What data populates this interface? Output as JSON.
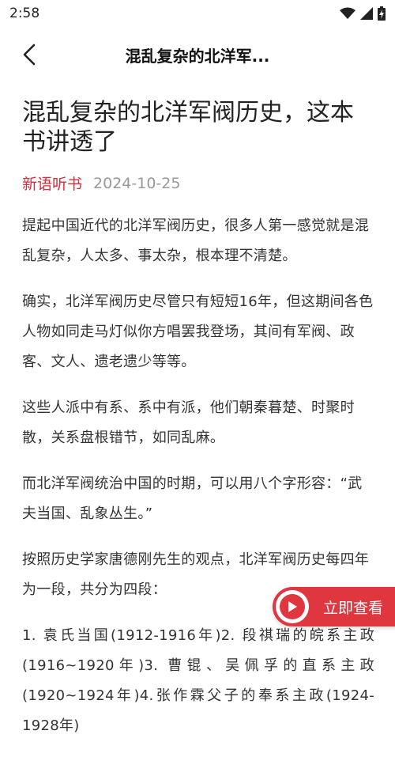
{
  "status": {
    "time": "2:58"
  },
  "nav": {
    "title": "混乱复杂的北洋军..."
  },
  "article": {
    "title": "混乱复杂的北洋军阀历史，这本书讲透了",
    "source": "新语听书",
    "date": "2024-10-25",
    "paragraphs": [
      "提起中国近代的北洋军阀历史，很多人第一感觉就是混乱复杂，人太多、事太杂，根本理不清楚。",
      "确实，北洋军阀历史尽管只有短短16年，但这期间各色人物如同走马灯似你方唱罢我登场，其间有军阀、政客、文人、遗老遗少等等。",
      "这些人派中有系、系中有派，他们朝秦暮楚、时聚时散，关系盘根错节，如同乱麻。",
      "而北洋军阀统治中国的时期，可以用八个字形容：“武夫当国、乱象丛生。”",
      "按照历史学家唐德刚先生的观点，北洋军阀历史每四年为一段，共分为四段：",
      "1. 袁氏当国(1912-1916年)2. 段祺瑞的皖系主政(1916~1920年)3. 曹锟、吴佩孚的直系主政(1920~1924年)4.张作霖父子的奉系主政(1924-1928年)"
    ]
  },
  "float_button": {
    "label": "立即查看"
  }
}
